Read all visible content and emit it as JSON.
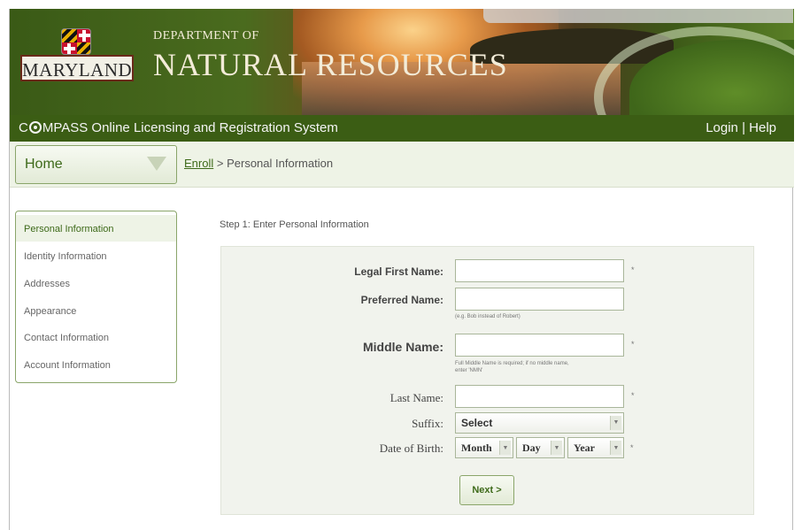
{
  "header": {
    "logo_text": "MARYLAND",
    "dept_small": "DEPARTMENT OF",
    "dept_big": "NATURAL RESOURCES"
  },
  "titlebar": {
    "system_prefix": "C",
    "system_rest": "MPASS Online Licensing and Registration System",
    "login_label": "Login",
    "separator": "|",
    "help_label": "Help"
  },
  "nav": {
    "home_label": "Home",
    "breadcrumb_link": "Enroll",
    "breadcrumb_sep": ">",
    "breadcrumb_current": "Personal Information"
  },
  "sidebar": {
    "items": [
      {
        "label": "Personal Information",
        "active": true
      },
      {
        "label": "Identity Information",
        "active": false
      },
      {
        "label": "Addresses",
        "active": false
      },
      {
        "label": "Appearance",
        "active": false
      },
      {
        "label": "Contact Information",
        "active": false
      },
      {
        "label": "Account Information",
        "active": false
      }
    ]
  },
  "form": {
    "step_title": "Step 1: Enter Personal Information",
    "legal_first_name_label": "Legal First Name:",
    "preferred_name_label": "Preferred Name:",
    "preferred_hint": "(e.g. Bob instead of Robert)",
    "middle_name_label": "Middle Name:",
    "middle_hint_line1": "Full Middle Name is required; if no middle name,",
    "middle_hint_line2": "enter 'NMN'",
    "last_name_label": "Last Name:",
    "suffix_label": "Suffix:",
    "suffix_value": "Select",
    "dob_label": "Date of Birth:",
    "dob_month": "Month",
    "dob_day": "Day",
    "dob_year": "Year",
    "required_mark": "*",
    "next_label": "Next >"
  },
  "colors": {
    "brand_green": "#3b5d14",
    "accent_green": "#3e6a1a"
  }
}
